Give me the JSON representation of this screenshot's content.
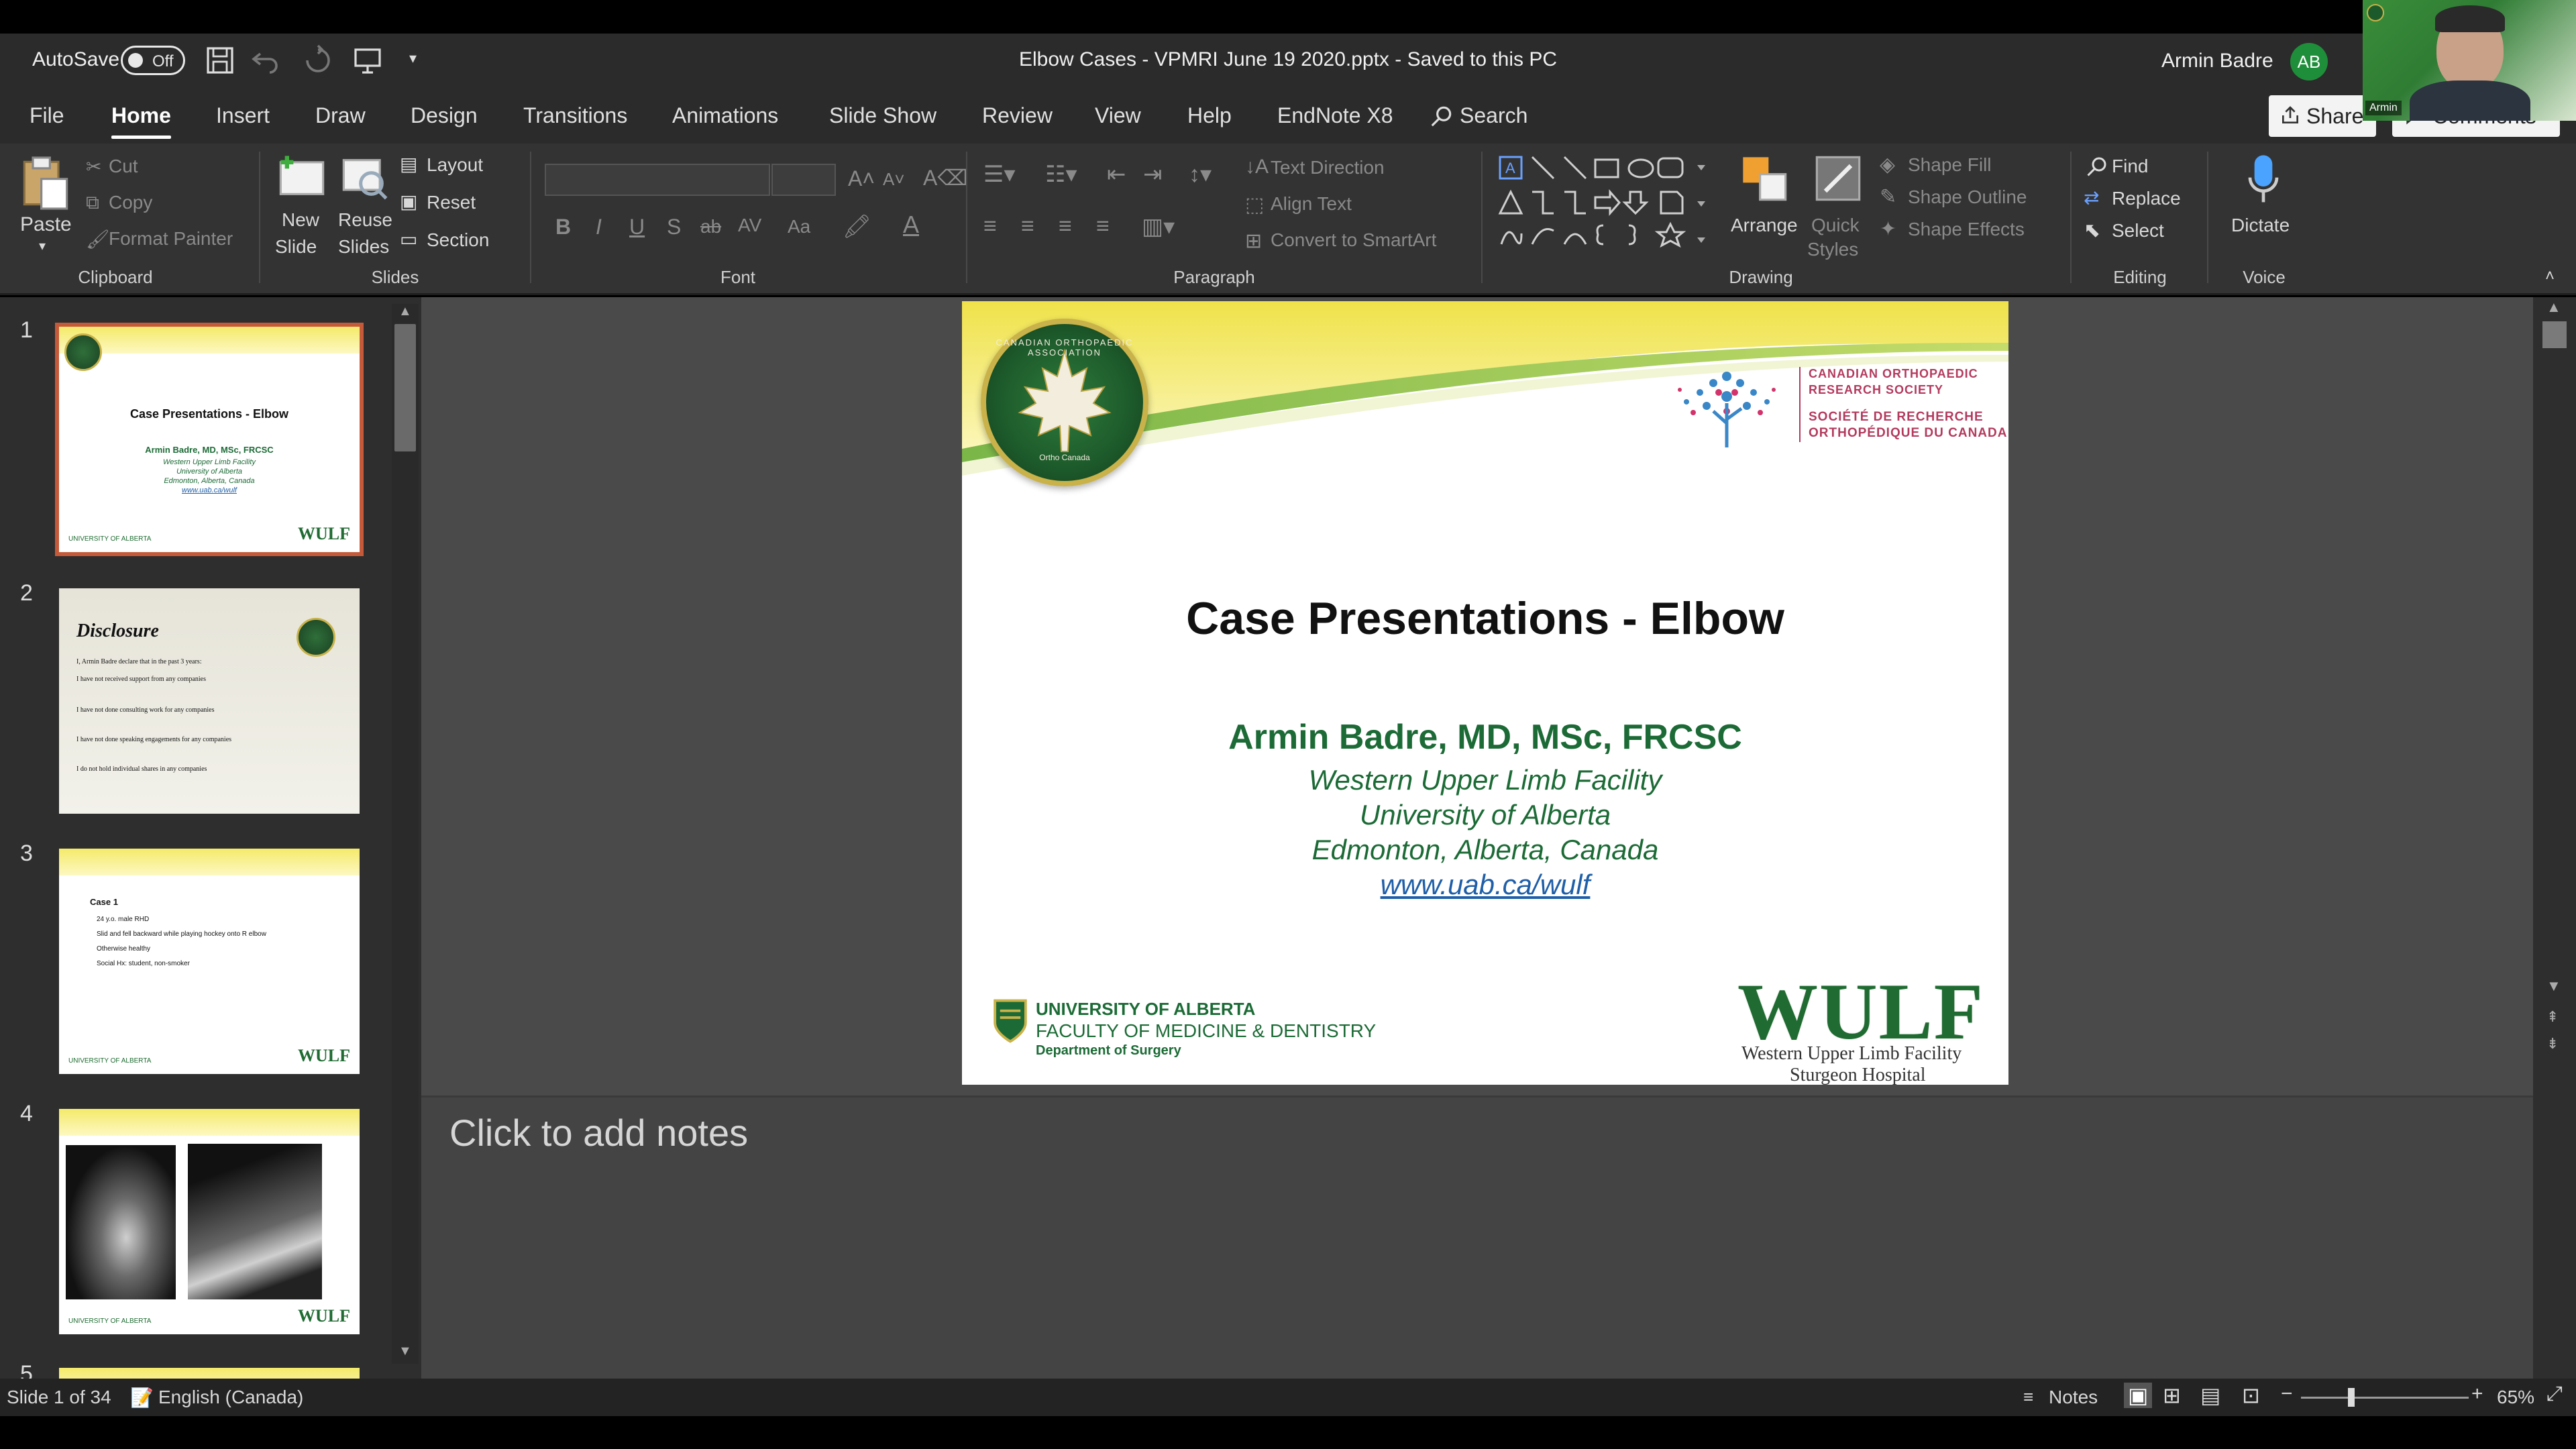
{
  "titlebar": {
    "autosave_label": "AutoSave",
    "autosave_state": "Off",
    "document_title": "Elbow Cases - VPMRI June 19 2020.pptx  -  Saved to this PC",
    "user_name": "Armin Badre",
    "user_initials": "AB"
  },
  "tabs": [
    "File",
    "Home",
    "Insert",
    "Draw",
    "Design",
    "Transitions",
    "Animations",
    "Slide Show",
    "Review",
    "View",
    "Help",
    "EndNote X8"
  ],
  "active_tab": "Home",
  "search_label": "Search",
  "share_label": "Share",
  "comments_label": "Comments",
  "ribbon": {
    "clipboard": {
      "label": "Clipboard",
      "paste": "Paste",
      "cut": "Cut",
      "copy": "Copy",
      "format_painter": "Format Painter"
    },
    "slides": {
      "label": "Slides",
      "new_slide_1": "New",
      "new_slide_2": "Slide",
      "reuse_1": "Reuse",
      "reuse_2": "Slides",
      "layout": "Layout",
      "reset": "Reset",
      "section": "Section"
    },
    "font": {
      "label": "Font",
      "bold": "B",
      "italic": "I",
      "underline": "U",
      "shadow": "S",
      "strike": "ab",
      "spacing": "AV",
      "case": "Aa"
    },
    "paragraph": {
      "label": "Paragraph",
      "text_direction": "Text Direction",
      "align_text": "Align Text",
      "smartart": "Convert to SmartArt"
    },
    "drawing": {
      "label": "Drawing",
      "arrange": "Arrange",
      "quick_styles_1": "Quick",
      "quick_styles_2": "Styles",
      "shape_fill": "Shape Fill",
      "shape_outline": "Shape Outline",
      "shape_effects": "Shape Effects"
    },
    "editing": {
      "label": "Editing",
      "find": "Find",
      "replace": "Replace",
      "select": "Select"
    },
    "voice": {
      "label": "Voice",
      "dictate": "Dictate"
    }
  },
  "thumbnails": [
    {
      "num": "1",
      "title": "Case Presentations - Elbow",
      "author": "Armin Badre, MD, MSc, FRCSC",
      "lines": [
        "Western Upper Limb Facility",
        "University of Alberta",
        "Edmonton, Alberta, Canada",
        "www.uab.ca/wulf"
      ]
    },
    {
      "num": "2",
      "title": "Disclosure",
      "lines": [
        "I, Armin Badre declare that in the past 3 years:",
        "I have not received support from any companies",
        "I have not done consulting work for any companies",
        "I have not done speaking engagements for any companies",
        "I do not hold individual shares in any companies"
      ]
    },
    {
      "num": "3",
      "title": "Case 1",
      "lines": [
        "24 y.o. male RHD",
        "Slid and fell backward while playing hockey onto R elbow",
        "Otherwise healthy",
        "Social Hx: student, non-smoker"
      ]
    },
    {
      "num": "4"
    },
    {
      "num": "5"
    }
  ],
  "thumb_footer": "UNIVERSITY OF ALBERTA",
  "thumb_wulf": "WULF",
  "slide": {
    "seal_text": "CANADIAN ORTHOPAEDIC ASSOCIATION",
    "seal_motto": "Ortho Canada",
    "society_en_1": "CANADIAN ORTHOPAEDIC",
    "society_en_2": "RESEARCH SOCIETY",
    "society_fr_1": "SOCIÉTÉ DE RECHERCHE",
    "society_fr_2": "ORTHOPÉDIQUE DU CANADA",
    "title": "Case Presentations - Elbow",
    "author": "Armin Badre, MD, MSc, FRCSC",
    "line1": "Western Upper Limb Facility",
    "line2": "University of Alberta",
    "line3": "Edmonton, Alberta, Canada",
    "link": "www.uab.ca/wulf",
    "uofa_1": "UNIVERSITY OF ALBERTA",
    "uofa_2": "FACULTY OF MEDICINE & DENTISTRY",
    "uofa_3": "Department of Surgery",
    "wulf": "WULF",
    "wulf_sub1": "Western Upper Limb Facility",
    "wulf_sub2": "Sturgeon Hospital"
  },
  "notes_placeholder": "Click to add notes",
  "status": {
    "slide_count": "Slide 1 of 34",
    "language": "English (Canada)",
    "notes": "Notes",
    "zoom": "65%"
  },
  "webcam_name": "Armin",
  "colors": {
    "accent_green": "#1c6b36",
    "selected_thumb": "#c55a3a",
    "link_blue": "#1f5fa8"
  }
}
